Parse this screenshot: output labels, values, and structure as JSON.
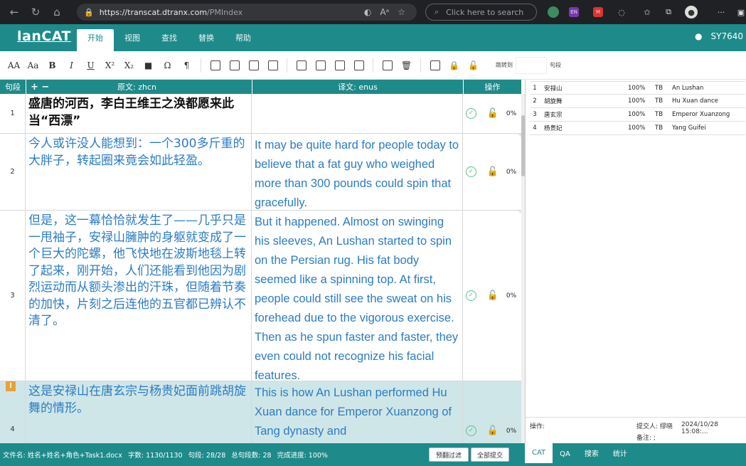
{
  "browser": {
    "url_host": "https://transcat.dtranx.com",
    "url_path": "/PMIndex",
    "search_placeholder": "Click here to search"
  },
  "app": {
    "logo": "lanCAT",
    "menu": [
      "开始",
      "视图",
      "查找",
      "替换",
      "帮助"
    ],
    "active_menu": 0,
    "user": "SY7640"
  },
  "toolbar": {
    "items": [
      "AA",
      "Aa",
      "B",
      "I",
      "U",
      "X²",
      "X₂",
      "■",
      "Ω",
      "¶"
    ],
    "label_left": "跳转到",
    "label_right": "句段"
  },
  "grid": {
    "col_num": "句段",
    "col_add": "+ −",
    "col_src": "原文: zhcn",
    "col_tgt": "译文: enus",
    "col_ops": "操作"
  },
  "segments": [
    {
      "id": "1",
      "src": "盛唐的河西，李白王维王之涣都愿来此当“西漂”",
      "tgt": "",
      "pct": "0%"
    },
    {
      "id": "2",
      "src": "今人或许没人能想到：一个300多斤重的大胖子，转起圈来竟会如此轻盈。",
      "tgt": "It may be quite hard for people today to believe that a fat guy who weighed more than 300 pounds could spin that gracefully.",
      "pct": "0%"
    },
    {
      "id": "3",
      "src": "但是，这一幕恰恰就发生了——几乎只是一甩袖子，安禄山臃肿的身躯就变成了一个巨大的陀螺，他飞快地在波斯地毯上转了起来，刚开始，人们还能看到他因为剧烈运动而从额头渗出的汗珠，但随着节奏的加快，片刻之后连他的五官都已辨认不清了。",
      "tgt": "But it happened. Almost on swinging his sleeves, An Lushan started to spin on the Persian rug. His fat body seemed like a spinning top. At first, people could still see the sweat on his forehead due to the vigorous exercise. Then as he spun faster and faster, they even could not recognize his facial features.",
      "pct": "0%"
    },
    {
      "id": "4",
      "src": "这是安禄山在唐玄宗与杨贵妃面前跳胡旋舞的情形。",
      "tgt": "This is how An Lushan performed Hu Xuan dance for Emperor Xuanzong of Tang dynasty and",
      "pct": "0%",
      "warn": "!"
    }
  ],
  "termbase": [
    {
      "n": "1",
      "src": "安禄山",
      "pct": "100%",
      "type": "TB",
      "tgt": "An Lushan"
    },
    {
      "n": "2",
      "src": "胡旋舞",
      "pct": "100%",
      "type": "TB",
      "tgt": "Hu Xuan dance"
    },
    {
      "n": "3",
      "src": "唐玄宗",
      "pct": "100%",
      "type": "TB",
      "tgt": "Emperor Xuanzong"
    },
    {
      "n": "4",
      "src": "杨贵妃",
      "pct": "100%",
      "type": "TB",
      "tgt": "Yang Guifei"
    }
  ],
  "panel_footer": {
    "op_label": "操作:",
    "submitter": "提交人: 缪晓",
    "time": "2024/10/28 15:08:...",
    "note": "备注: ;"
  },
  "status": {
    "file": "文件名: 姓名+姓名+角色+Task1.docx",
    "words": "字数: 1130/1130",
    "segments": "句段: 28/28",
    "total": "总句段数: 28",
    "progress": "完成进度: 100%",
    "btn_filter": "预翻过滤",
    "btn_submit": "全部提交"
  },
  "right_tabs": [
    "CAT",
    "QA",
    "搜索",
    "统计"
  ],
  "active_right_tab": 0
}
